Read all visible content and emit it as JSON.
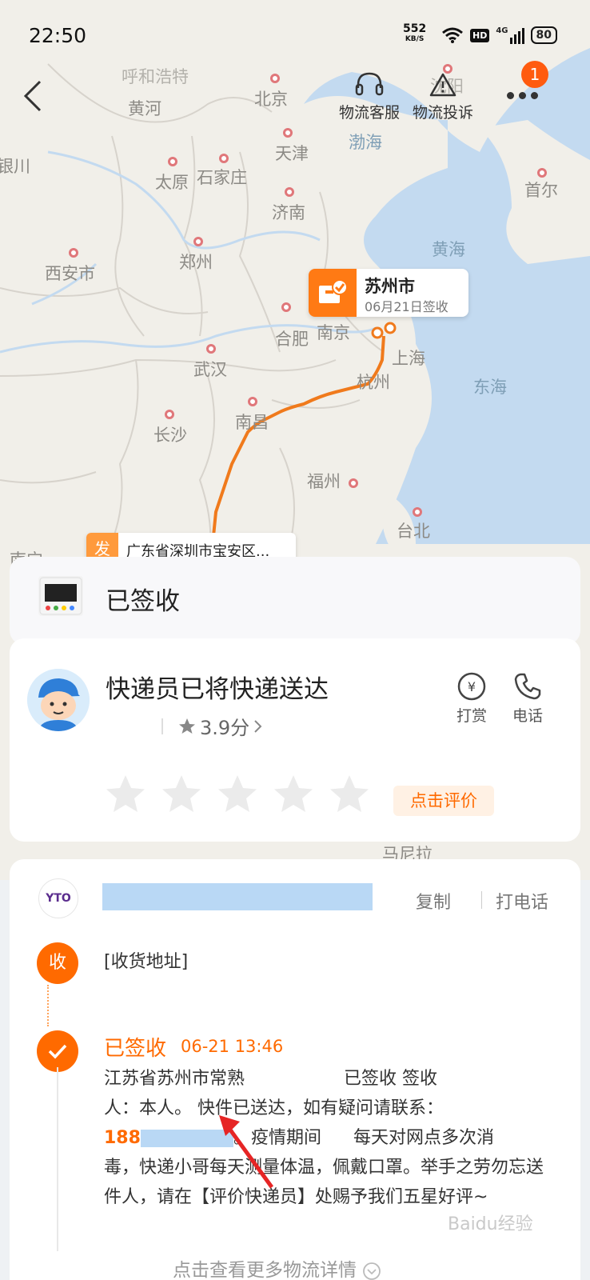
{
  "status_bar": {
    "time": "22:50",
    "speed_value": "552",
    "speed_unit": "KB/S",
    "hd": "HD",
    "network": "4G",
    "battery": "80"
  },
  "top_nav": {
    "service_label": "物流客服",
    "complaint_label": "物流投诉",
    "badge_count": "1"
  },
  "map": {
    "cities": [
      "呼和浩特",
      "黄河",
      "北京",
      "沈阳",
      "银川",
      "天津",
      "渤海",
      "首尔",
      "太原",
      "石家庄",
      "济南",
      "西安市",
      "郑州",
      "黄海",
      "合肥",
      "南京",
      "上海",
      "武汉",
      "杭州",
      "东海",
      "长沙",
      "南昌",
      "福州",
      "台北",
      "南宁",
      "马尼拉"
    ],
    "destination": {
      "city": "苏州市",
      "date": "06月21日签收"
    },
    "origin": {
      "tag": "发",
      "address": "广东省深圳市宝安区..."
    }
  },
  "status_card": {
    "status": "已签收"
  },
  "courier_card": {
    "title": "快递员已将快递送达",
    "rating": "3.9分",
    "tip_label": "打赏",
    "call_label": "电话",
    "rate_button": "点击评价"
  },
  "tracking_card": {
    "carrier_logo": "YTO",
    "copy_label": "复制",
    "call_label": "打电话",
    "receive_icon": "收",
    "address_label": "[收货地址]",
    "event": {
      "title": "已签收",
      "time": "06-21  13:46",
      "line1": "江苏省苏州市常熟",
      "line1b": "已签收 签收",
      "line2": "人：本人。 快件已送达，如有疑问请联系：",
      "phone_prefix": "188",
      "line3": "。疫情期间",
      "line3b": "每天对网点多次消",
      "line4": "毒，快递小哥每天测量体温，佩戴口罩。举手之劳勿忘送件人，请在【评价快递员】处赐予我们五星好评~"
    },
    "more_link": "点击查看更多物流详情"
  },
  "watermark": "Baidu经验",
  "colors": {
    "accent": "#ff6a00",
    "route": "#f07a1c",
    "highlight": "#b9d8f5"
  }
}
